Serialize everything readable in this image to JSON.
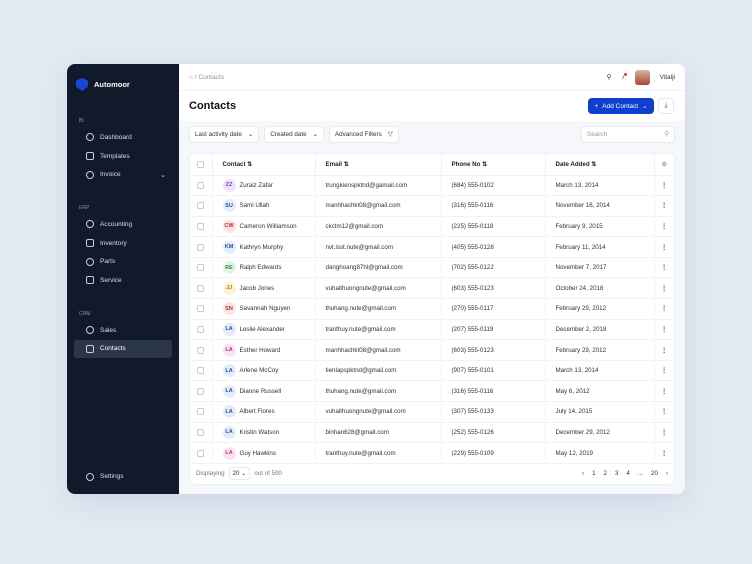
{
  "app": {
    "name": "Automoor"
  },
  "sidebar": {
    "sections": [
      {
        "label": "BI",
        "items": [
          {
            "label": "Dashboard",
            "icon": "dashboard-icon"
          },
          {
            "label": "Templates",
            "icon": "file-icon"
          },
          {
            "label": "Invoice",
            "icon": "invoice-icon",
            "chevron": "⌄"
          }
        ]
      },
      {
        "label": "ERP",
        "items": [
          {
            "label": "Accounting",
            "icon": "gauge-icon"
          },
          {
            "label": "Inventory",
            "icon": "truck-icon"
          },
          {
            "label": "Parts",
            "icon": "parts-icon"
          },
          {
            "label": "Service",
            "icon": "service-icon"
          }
        ]
      },
      {
        "label": "CRM",
        "items": [
          {
            "label": "Sales",
            "icon": "plus-circle-icon"
          },
          {
            "label": "Contacts",
            "icon": "users-icon"
          }
        ]
      }
    ],
    "settings": "Settings"
  },
  "header": {
    "breadcrumb": "Contacts",
    "breadcrumb_sep": "/",
    "user": "Vitalji"
  },
  "page": {
    "title": "Contacts",
    "add_button": "Add Contact",
    "add_plus": "+",
    "add_chevron": "⌄",
    "download": "⤓"
  },
  "filters": {
    "last_activity": "Last activity date",
    "created": "Created date",
    "advanced": "Advanced Filters",
    "search_placeholder": "Search"
  },
  "table": {
    "columns": [
      "Contact ⇅",
      "Email ⇅",
      "Phone No ⇅",
      "Date Added ⇅"
    ],
    "rows": [
      [
        "ZZ",
        "Zuraiz Zafar",
        "trungkienspktnd@gamail.com",
        "(684) 555-0102",
        "March 13, 2014",
        "#efe3fb",
        "#7b3fc4"
      ],
      [
        "SU",
        "Sami Ullah",
        "manhhachkt08@gmail.com",
        "(316) 555-0116",
        "November 16, 2014",
        "#e3ecfb",
        "#2d4ea8"
      ],
      [
        "CW",
        "Cameron Williamson",
        "ckctm12@gmail.com",
        "(225) 555-0118",
        "February 9, 2015",
        "#fde4e4",
        "#b8302f"
      ],
      [
        "KM",
        "Kathryn Murphy",
        "nvt.isst.nute@gmail.com",
        "(405) 555-0128",
        "February 11, 2014",
        "#e3ecfb",
        "#2d4ea8"
      ],
      [
        "RE",
        "Ralph Edwards",
        "danghoang87hl@gmail.com",
        "(702) 555-0122",
        "November 7, 2017",
        "#e1f6e6",
        "#2b8a45"
      ],
      [
        "JJ",
        "Jacob Jones",
        "vuhaithuongnute@gmail.com",
        "(603) 555-0123",
        "October 24, 2018",
        "#fdf3d3",
        "#a07a10"
      ],
      [
        "SN",
        "Savannah Nguyen",
        "thuhang.nute@gmail.com",
        "(270) 555-0117",
        "February 29, 2012",
        "#fde4e4",
        "#b8302f"
      ],
      [
        "LA",
        "Leslie Alexander",
        "tranthuy.nute@gmail.com",
        "(207) 555-0119",
        "December 2, 2018",
        "#e3ecfb",
        "#2d4ea8"
      ],
      [
        "LA",
        "Esther Howard",
        "manhhachkt08@gmail.com",
        "(603) 555-0123",
        "February 29, 2012",
        "#fbe3f2",
        "#b03580"
      ],
      [
        "LA",
        "Arlene McCoy",
        "tienlapspktnd@gmail.com",
        "(907) 555-0101",
        "March 13, 2014",
        "#e3ecfb",
        "#2d4ea8"
      ],
      [
        "LA",
        "Dianne Russell",
        "thuhang.nute@gmail.com",
        "(316) 555-0116",
        "May 6, 2012",
        "#e3ecfb",
        "#2d4ea8"
      ],
      [
        "LA",
        "Albert Flores",
        "vuhaithuongnute@gmail.com",
        "(307) 555-0133",
        "July 14, 2015",
        "#e3ecfb",
        "#2d4ea8"
      ],
      [
        "LA",
        "Kristin Watson",
        "binhan628@gmail.com",
        "(252) 555-0126",
        "December 29, 2012",
        "#e3ecfb",
        "#2d4ea8"
      ],
      [
        "LA",
        "Guy Hawkins",
        "tranthuy.nute@gmail.com",
        "(229) 555-0109",
        "May 12, 2019",
        "#fbe3f2",
        "#b03580"
      ]
    ]
  },
  "footer": {
    "displaying": "Displaying",
    "per_page": "20",
    "out_of": "out of 500",
    "pages": [
      "1",
      "2",
      "3",
      "4",
      "...",
      "20"
    ],
    "prev": "‹",
    "next": "›"
  }
}
